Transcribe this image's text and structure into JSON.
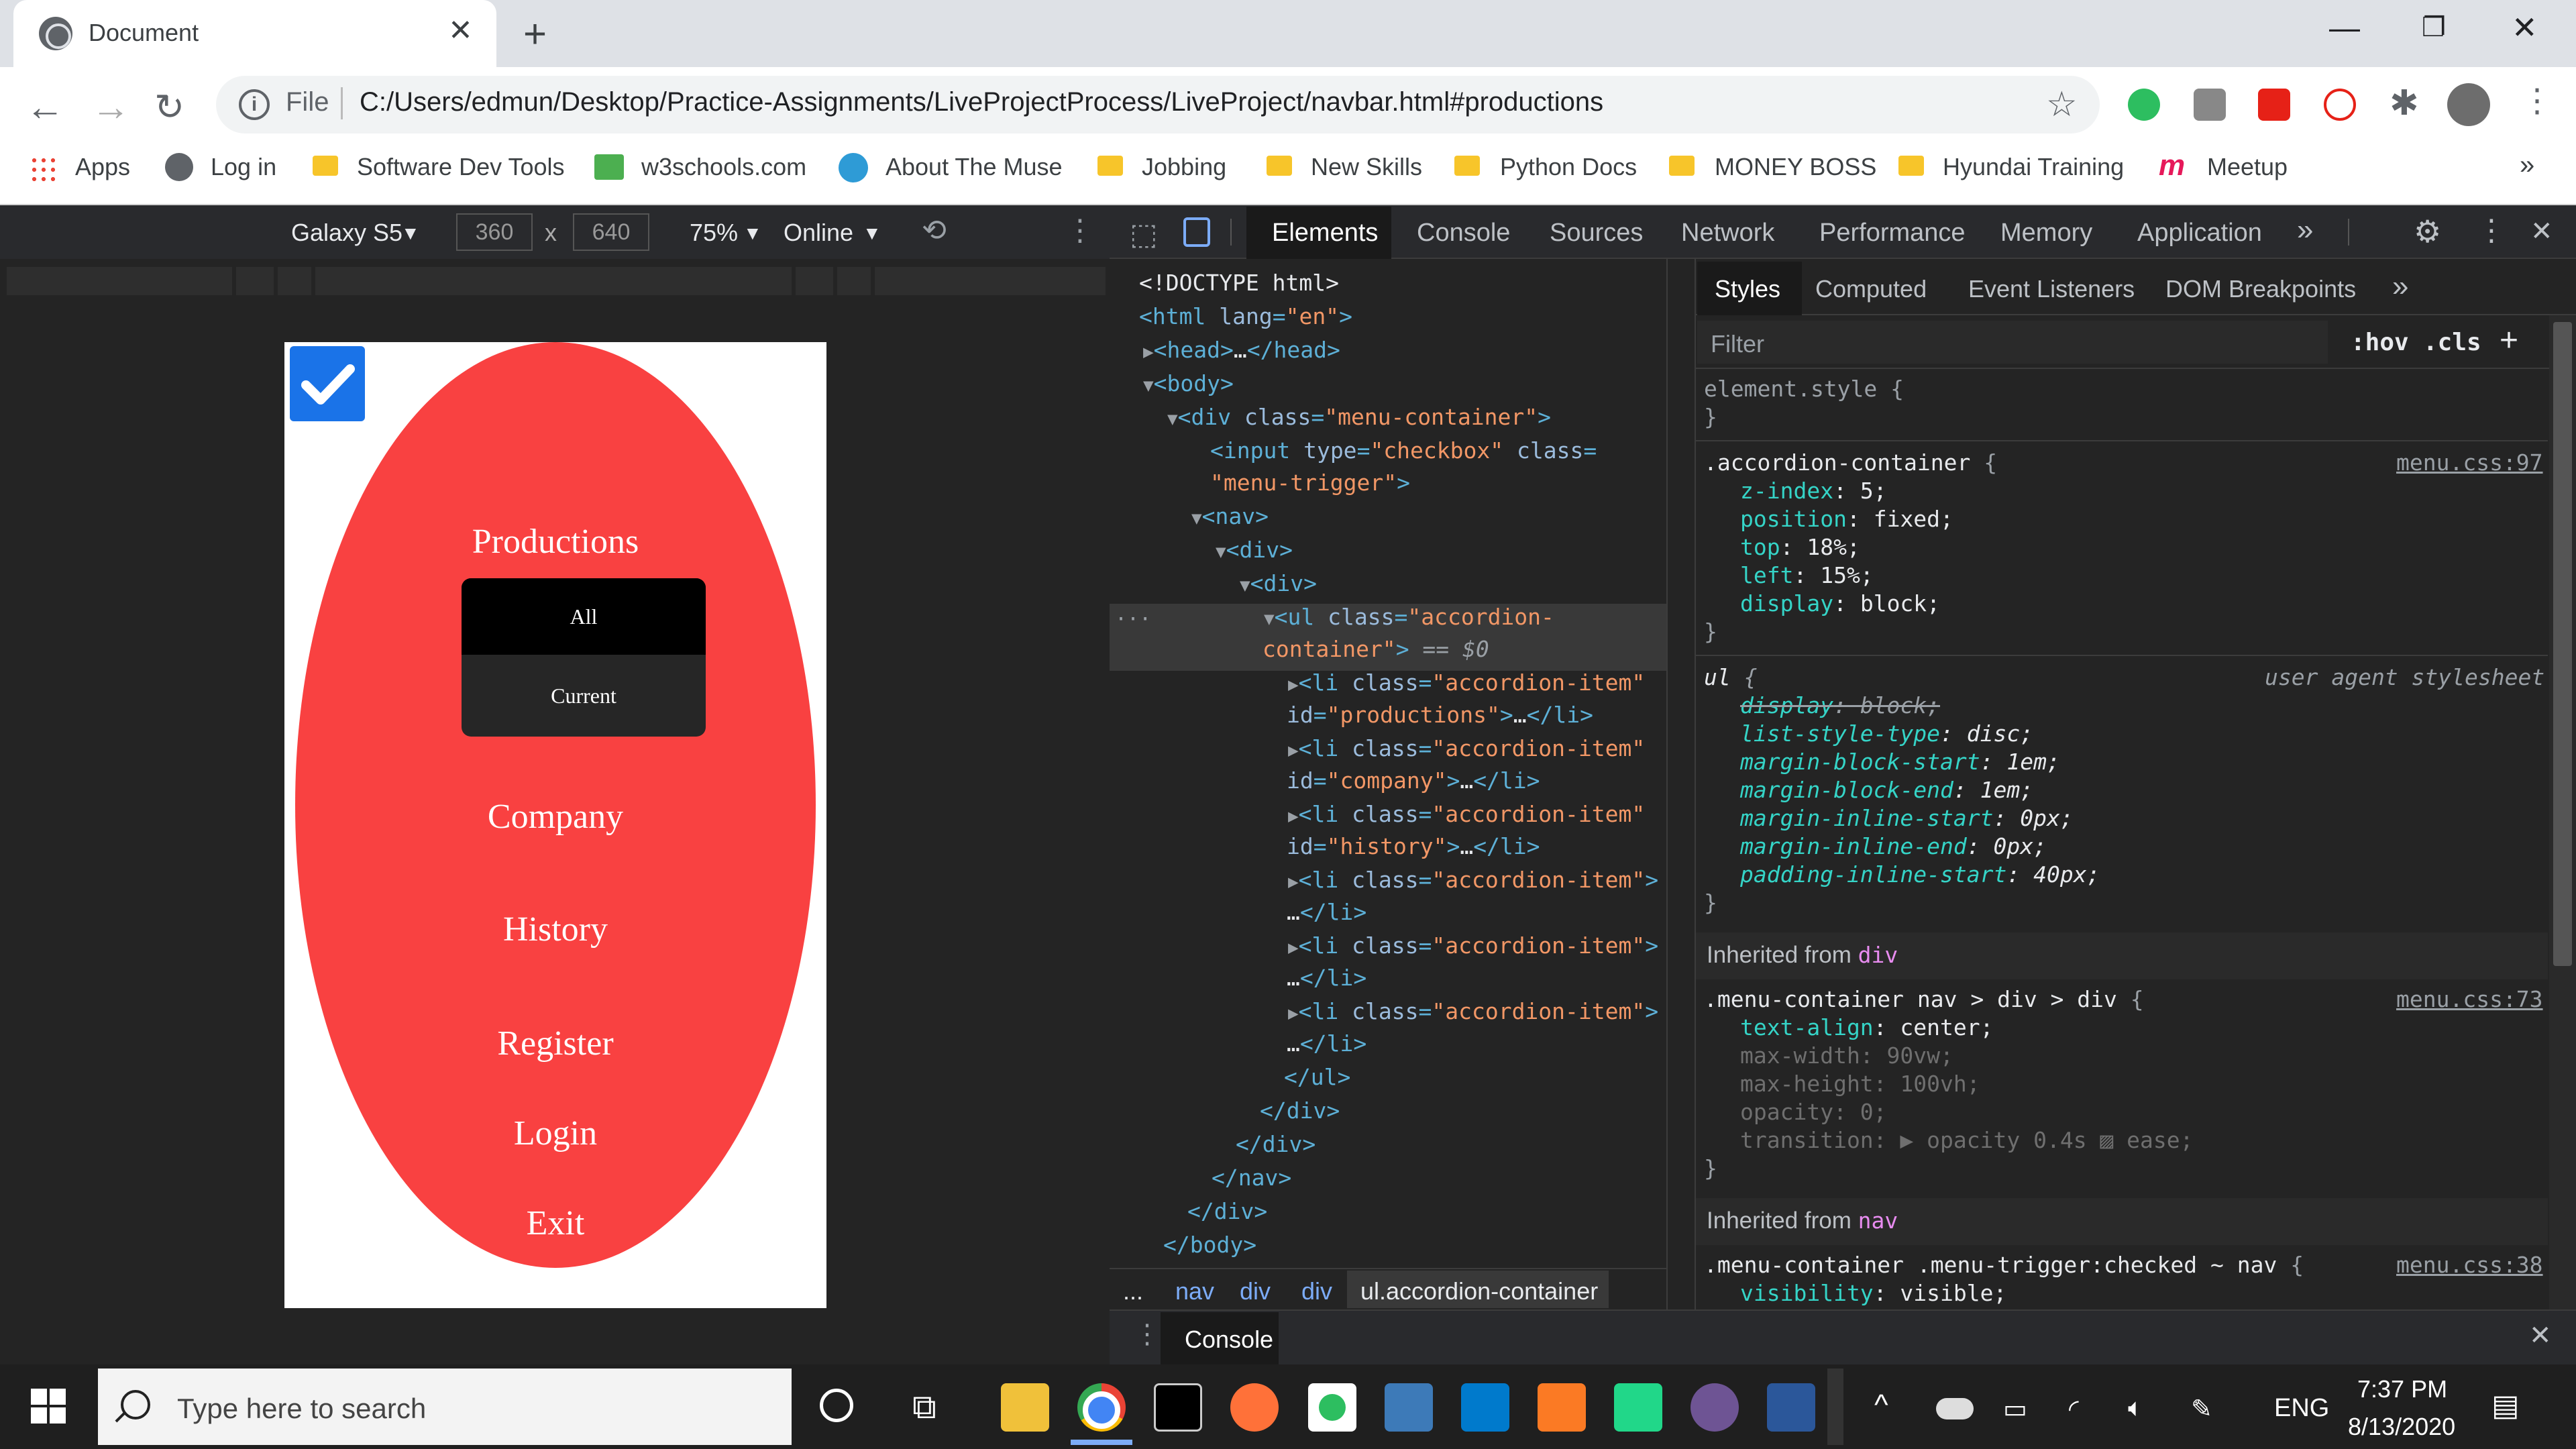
{
  "browser": {
    "tab_title": "Document",
    "file_label": "File",
    "url": "C:/Users/edmun/Desktop/Practice-Assignments/LiveProjectProcess/LiveProject/navbar.html#productions",
    "bookmarks": [
      "Apps",
      "Log in",
      "Software Dev Tools",
      "w3schools.com",
      "About The Muse",
      "Jobbing",
      "New Skills",
      "Python Docs",
      "MONEY BOSS",
      "Hyundai Training",
      "Meetup"
    ]
  },
  "device_toolbar": {
    "device": "Galaxy S5",
    "width": "360",
    "height": "640",
    "x": "x",
    "zoom": "75%",
    "network": "Online"
  },
  "page": {
    "menu": [
      "Productions",
      "Company",
      "History",
      "Register",
      "Login",
      "Exit"
    ],
    "submenu": [
      "All",
      "Current"
    ],
    "colors": {
      "oval": "#f94141",
      "checkbox": "#1a73e8"
    }
  },
  "devtools": {
    "tabs": [
      "Elements",
      "Console",
      "Sources",
      "Network",
      "Performance",
      "Memory",
      "Application"
    ],
    "styles_tabs": [
      "Styles",
      "Computed",
      "Event Listeners",
      "DOM Breakpoints"
    ],
    "filter_placeholder": "Filter",
    "hov": ":hov",
    "cls": ".cls",
    "breadcrumb": [
      "...",
      "nav",
      "div",
      "div",
      "ul.accordion-container"
    ],
    "console_label": "Console"
  },
  "taskbar": {
    "search_placeholder": "Type here to search",
    "lang": "ENG",
    "time": "7:37 PM",
    "date": "8/13/2020"
  }
}
